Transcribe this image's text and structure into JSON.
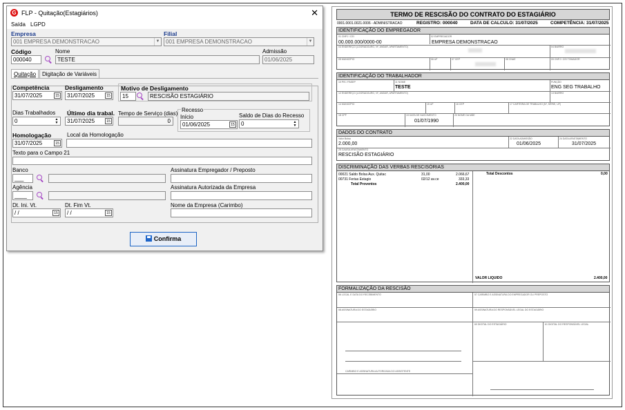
{
  "dialog": {
    "title": "FLP - Quitação(Estagiários)",
    "close_glyph": "✕",
    "logo_letter": "G",
    "menu": [
      "Saída",
      "LGPD"
    ],
    "empresa_label": "Empresa",
    "empresa_value": "001 EMPRESA DEMONSTRACAO",
    "filial_label": "Filial",
    "filial_value": "001 EMPRESA DEMONSTRACAO",
    "codigo_label": "Código",
    "codigo_value": "000040",
    "nome_label": "Nome",
    "nome_value": "TESTE",
    "admissao_label": "Admissão",
    "admissao_value": "01/06/2025",
    "tabs": [
      "Quitação",
      "Digitação de Variáveis"
    ],
    "competencia_label": "Competência",
    "competencia_value": "31/07/2025",
    "desligamento_label": "Desligamento",
    "desligamento_value": "31/07/2025",
    "motivo_label": "Motivo de Desligamento",
    "motivo_code": "15",
    "motivo_value": "RESCISÃO ESTAGIÁRIO",
    "dias_trab_label": "Dias Trabalhados",
    "dias_trab_value": "0",
    "ultimo_dia_label": "Último dia trabal.",
    "ultimo_dia_value": "31/07/2025",
    "tempo_servico_label": "Tempo de Serviço (dias)",
    "tempo_servico_value": "0",
    "recesso_label": "Recesso",
    "inicio_label": "Início",
    "inicio_value": "01/06/2025",
    "saldo_label": "Saldo de Dias do Recesso",
    "saldo_value": "0",
    "homologacao_label": "Homologação",
    "homologacao_value": "31/07/2025",
    "local_homolog_label": "Local da Homologação",
    "local_homolog_value": "",
    "texto_campo_label": "Texto para o Campo 21",
    "banco_label": "Banco",
    "banco_value": "___",
    "agencia_label": "Agência",
    "agencia_value": "____",
    "assin_empregador_label": "Assinatura Empregador / Preposto",
    "assin_autorizada_label": "Assinatura Autorizada da Empresa",
    "dt_ini_label": "Dt. Ini. Vt.",
    "dt_ini_value": " / /",
    "dt_fim_label": "Dt. Fim Vt.",
    "dt_fim_value": " / /",
    "nome_empresa_label": "Nome da Empresa (Carimbo)",
    "confirm_label": "Confirma"
  },
  "report": {
    "title": "TERMO DE RESCISÃO DO CONTRATO DO ESTAGIÁRIO",
    "header_left": "0001.0001.0021.0006 - ADMINISTRACAO",
    "registro": "REGISTRO: 000040",
    "data_calculo": "DATA DE CALCULO: 31/07/2025",
    "competencia": "COMPETÊNCIA: 31/07/2025",
    "sec_empregador": "IDENTIFICAÇÃO DO EMPREGADOR",
    "cnpj_value": "00.000.000/0000-00",
    "razao_social": "EMPRESA DEMONSTRACAO",
    "sec_trabalhador": "IDENTIFICAÇÃO DO TRABALHADOR",
    "trab_nome": "TESTE",
    "funcao": "ENG SEG TRABALHO",
    "nascimento": "01/07/1990",
    "sec_contrato": "DADOS DO CONTRATO",
    "valor_bolsa": "2.000,00",
    "data_admissao": "01/06/2025",
    "data_afastamento": "31/07/2025",
    "causa": "RESCISÃO ESTAGIÁRIO",
    "sec_verbas": "DISCRIMINAÇÃO DAS VERBAS RESCISÓRIAS",
    "verbas": [
      {
        "code": "00021",
        "desc": "Saldo Bolsa Aux. Quitac",
        "ref": "31,00",
        "value": "2.066,67"
      },
      {
        "code": "00731",
        "desc": "Ferias Estagio",
        "ref": "02/12 av.ce",
        "value": "333,33"
      }
    ],
    "total_proventos_label": "Total Proventos",
    "total_proventos": "2.400,00",
    "total_descontos_label": "Total Descontos",
    "total_descontos": "0,00",
    "valor_liquido_label": "VALOR LIQUIDO",
    "valor_liquido": "2.400,00",
    "sec_formalizacao": "FORMALIZAÇÃO DA RESCISÃO"
  }
}
